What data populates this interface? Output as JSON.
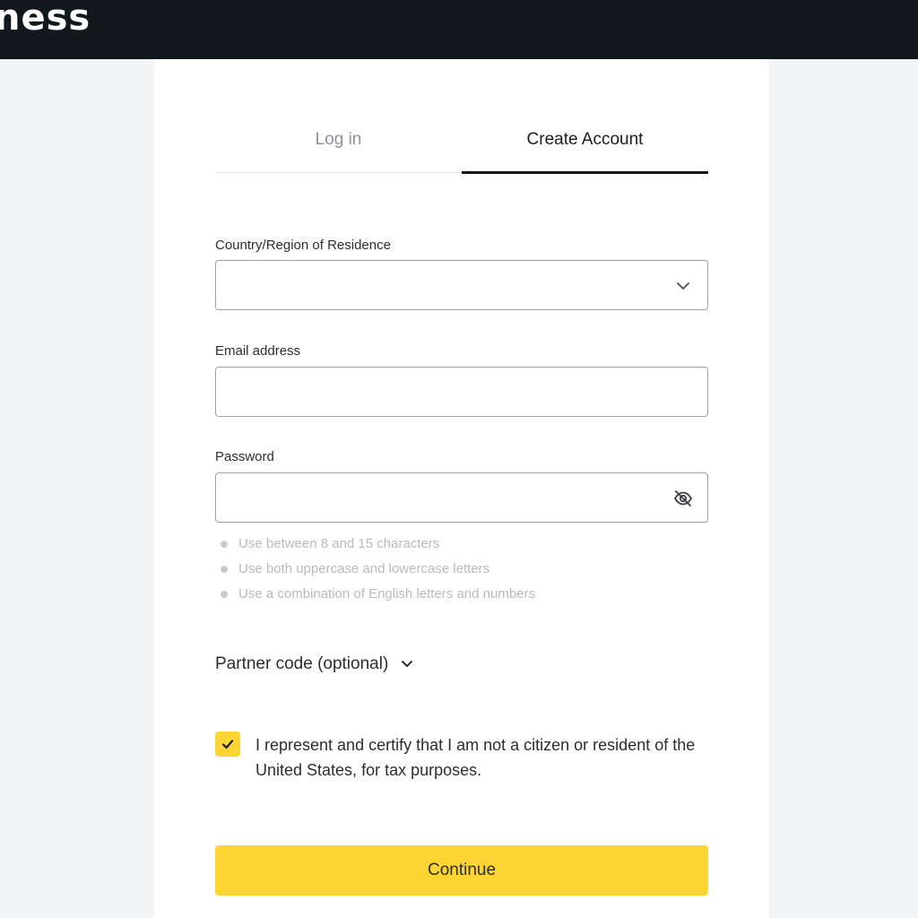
{
  "header": {
    "logo_text": "ness"
  },
  "tabs": [
    {
      "label": "Log in",
      "active": false
    },
    {
      "label": "Create Account",
      "active": true
    }
  ],
  "form": {
    "country": {
      "label": "Country/Region of Residence",
      "value": "",
      "icon": "chevron-down-icon"
    },
    "email": {
      "label": "Email address",
      "value": ""
    },
    "password": {
      "label": "Password",
      "value": "",
      "icon": "eye-off-icon"
    },
    "hints": [
      "Use between 8 and 15 characters",
      "Use both uppercase and lowercase letters",
      "Use a combination of English letters and numbers"
    ],
    "partner_code_label": "Partner code (optional)",
    "certify": {
      "checked": true,
      "text": "I represent and certify that I am not a citizen or resident of the United States, for tax purposes."
    },
    "continue_label": "Continue"
  },
  "colors": {
    "accent": "#fcd535",
    "topbar": "#12191d",
    "hint_text": "#b7bbbf"
  }
}
